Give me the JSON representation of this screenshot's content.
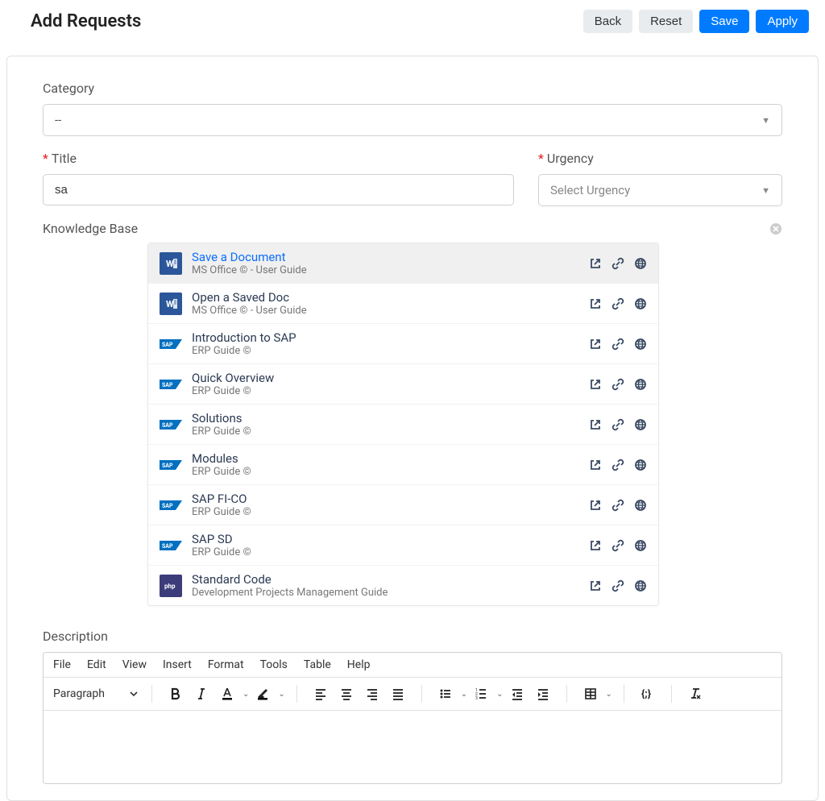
{
  "header": {
    "title": "Add Requests",
    "buttons": {
      "back": "Back",
      "reset": "Reset",
      "save": "Save",
      "apply": "Apply"
    }
  },
  "form": {
    "category": {
      "label": "Category",
      "value": "--"
    },
    "title": {
      "label": "Title",
      "value": "sa"
    },
    "urgency": {
      "label": "Urgency",
      "placeholder": "Select Urgency"
    },
    "knowledge_base": {
      "label": "Knowledge Base"
    },
    "description": {
      "label": "Description"
    }
  },
  "kb_items": [
    {
      "title": "Save a Document",
      "subtitle": "MS Office © - User Guide",
      "icon": "word",
      "highlight": true
    },
    {
      "title": "Open a Saved Doc",
      "subtitle": "MS Office © - User Guide",
      "icon": "word",
      "highlight": false
    },
    {
      "title": "Introduction to SAP",
      "subtitle": "ERP Guide ©",
      "icon": "sap",
      "highlight": false
    },
    {
      "title": "Quick Overview",
      "subtitle": "ERP Guide ©",
      "icon": "sap",
      "highlight": false
    },
    {
      "title": "Solutions",
      "subtitle": "ERP Guide ©",
      "icon": "sap",
      "highlight": false
    },
    {
      "title": "Modules",
      "subtitle": "ERP Guide ©",
      "icon": "sap",
      "highlight": false
    },
    {
      "title": "SAP FI-CO",
      "subtitle": "ERP Guide ©",
      "icon": "sap",
      "highlight": false
    },
    {
      "title": "SAP SD",
      "subtitle": "ERP Guide ©",
      "icon": "sap",
      "highlight": false
    },
    {
      "title": "Standard Code",
      "subtitle": "Development Projects Management Guide",
      "icon": "php",
      "highlight": false
    }
  ],
  "editor": {
    "menus": {
      "file": "File",
      "edit": "Edit",
      "view": "View",
      "insert": "Insert",
      "format": "Format",
      "tools": "Tools",
      "table": "Table",
      "help": "Help"
    },
    "paragraph": "Paragraph"
  }
}
